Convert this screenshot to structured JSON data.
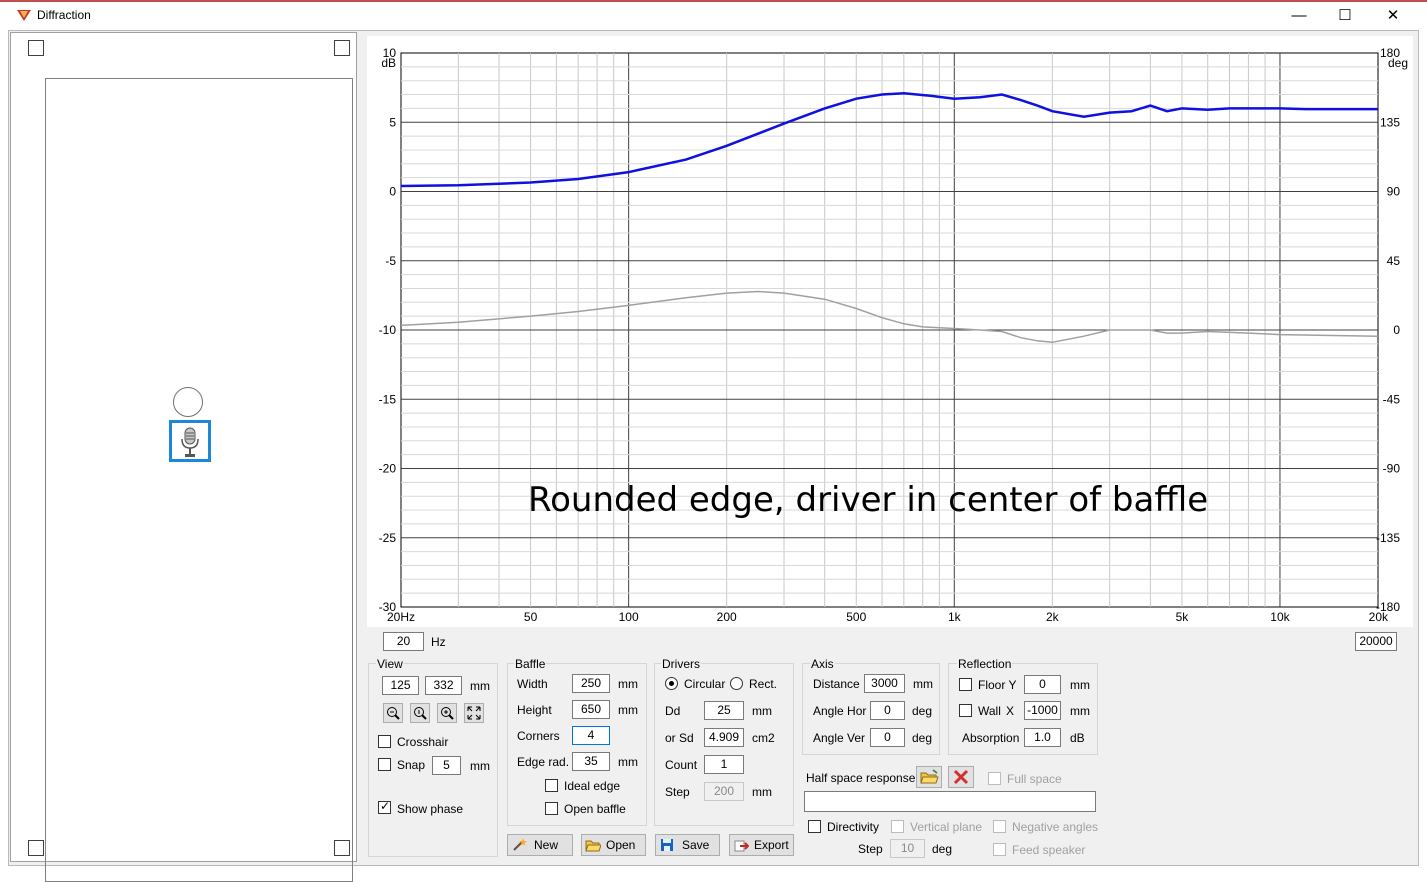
{
  "window": {
    "title": "Diffraction",
    "minimize": "—",
    "maximize": "☐",
    "close": "✕"
  },
  "plot": {
    "overlay": "Rounded edge, driver in center of baffle",
    "left_unit": "dB",
    "right_unit": "deg",
    "left_ticks": [
      "10",
      "5",
      "0",
      "-5",
      "-10",
      "-15",
      "-20",
      "-25",
      "-30"
    ],
    "right_ticks": [
      "180",
      "135",
      "90",
      "45",
      "0",
      "-45",
      "-90",
      "-135",
      "-180"
    ],
    "x_ticks": [
      "20Hz",
      "50",
      "100",
      "200",
      "500",
      "1k",
      "2k",
      "5k",
      "10k",
      "20k"
    ],
    "colors": {
      "magnitude": "#1010e0",
      "phase": "#a0a0a0"
    }
  },
  "chart_data": {
    "type": "line",
    "x_scale": "log",
    "xlim": [
      20,
      20000
    ],
    "ylim": [
      -30,
      10
    ],
    "y2lim": [
      -180,
      180
    ],
    "series": [
      {
        "axis": "left",
        "x": [
          20,
          30,
          50,
          70,
          100,
          150,
          200,
          300,
          400,
          500,
          600,
          700,
          850,
          1000,
          1200,
          1400,
          1600,
          1800,
          2000,
          2500,
          3000,
          3500,
          4000,
          4500,
          5000,
          6000,
          7000,
          8000,
          10000,
          12000,
          15000,
          20000
        ],
        "values": [
          0.4,
          0.45,
          0.65,
          0.9,
          1.4,
          2.3,
          3.3,
          4.9,
          6.0,
          6.7,
          7.0,
          7.1,
          6.9,
          6.7,
          6.8,
          7.0,
          6.6,
          6.2,
          5.8,
          5.4,
          5.7,
          5.8,
          6.2,
          5.8,
          6.0,
          5.9,
          6.0,
          6.0,
          6.0,
          5.95,
          5.95,
          5.95
        ]
      },
      {
        "axis": "right",
        "x": [
          20,
          30,
          50,
          70,
          100,
          150,
          200,
          250,
          300,
          400,
          500,
          600,
          700,
          800,
          1000,
          1200,
          1400,
          1600,
          1800,
          2000,
          2500,
          3000,
          3500,
          4000,
          4500,
          5000,
          6000,
          8000,
          10000,
          20000
        ],
        "values": [
          3,
          5,
          9,
          12,
          16,
          21,
          24,
          25,
          24,
          20,
          14,
          8,
          4,
          2,
          1,
          0,
          -1,
          -5,
          -7,
          -8,
          -4,
          0,
          0,
          0,
          -2,
          -2,
          -1,
          -2,
          -3,
          -4
        ]
      }
    ]
  },
  "range": {
    "min": "20",
    "hz_label": "Hz",
    "max": "20000"
  },
  "view": {
    "title": "View",
    "w": "125",
    "h": "332",
    "unit": "mm",
    "crosshair": "Crosshair",
    "snap": "Snap",
    "snap_value": "5",
    "snap_unit": "mm",
    "show_phase": "Show phase"
  },
  "baffle": {
    "title": "Baffle",
    "width_label": "Width",
    "width": "250",
    "height_label": "Height",
    "height": "650",
    "corners_label": "Corners",
    "corners": "4",
    "edge_label": "Edge rad.",
    "edge": "35",
    "unit": "mm",
    "ideal_edge": "Ideal edge",
    "open_baffle": "Open baffle"
  },
  "drivers": {
    "title": "Drivers",
    "circular": "Circular",
    "rect": "Rect.",
    "dd_label": "Dd",
    "dd": "25",
    "dd_unit": "mm",
    "sd_label": "or Sd",
    "sd": "4.909",
    "sd_unit": "cm2",
    "count_label": "Count",
    "count": "1",
    "step_label": "Step",
    "step": "200",
    "step_unit": "mm"
  },
  "axis": {
    "title": "Axis",
    "distance_label": "Distance",
    "distance": "3000",
    "distance_unit": "mm",
    "hor_label": "Angle Hor",
    "hor": "0",
    "ver_label": "Angle Ver",
    "ver": "0",
    "deg": "deg"
  },
  "reflection": {
    "title": "Reflection",
    "floor_label": "Floor Y",
    "floor": "0",
    "wall_label": "Wall",
    "wall_x": "X",
    "wall": "-1000",
    "unit": "mm",
    "absorption_label": "Absorption",
    "absorption": "1.0",
    "absorption_unit": "dB"
  },
  "half_space": {
    "label": "Half space response",
    "full_space": "Full space",
    "directivity": "Directivity",
    "vertical_plane": "Vertical plane",
    "negative_angles": "Negative angles",
    "feed_speaker": "Feed speaker",
    "step_label": "Step",
    "step": "10",
    "step_unit": "deg"
  },
  "buttons": {
    "new": "New",
    "open": "Open",
    "save": "Save",
    "export": "Export"
  },
  "icons": [
    "diffraction-app-icon",
    "microphone-icon",
    "zoom-out-icon",
    "zoom-reset-icon",
    "zoom-in-icon",
    "fit-icon",
    "folder-open-icon",
    "delete-icon",
    "new-wand-icon",
    "save-disk-icon",
    "export-icon"
  ]
}
